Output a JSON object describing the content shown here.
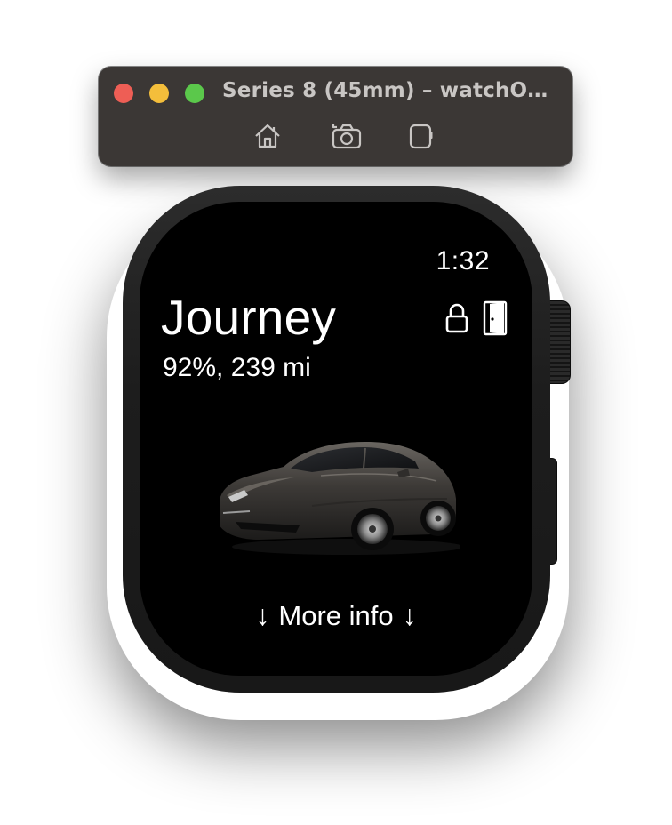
{
  "window": {
    "title": "Series 8 (45mm) – watchO…",
    "toolbar": {
      "home_icon": "home-icon",
      "screenshot_icon": "camera-icon",
      "rotate_icon": "device-icon"
    },
    "traffic_lights": {
      "close": "#ee5e55",
      "minimize": "#f4be3b",
      "zoom": "#5bc84b"
    }
  },
  "watch": {
    "status": {
      "time": "1:32"
    },
    "main": {
      "title": "Journey",
      "subtitle": "92%, 239 mi",
      "icons": [
        "lock-icon",
        "door-icon"
      ],
      "car_image": "car-image",
      "more_info": {
        "left_arrow": "↓",
        "label": "More info",
        "right_arrow": "↓"
      }
    }
  },
  "colors": {
    "screen_bg": "#000000",
    "text": "#ffffff",
    "titlebar_bg": "#3b3735",
    "titlebar_text": "#c9c6c4"
  }
}
